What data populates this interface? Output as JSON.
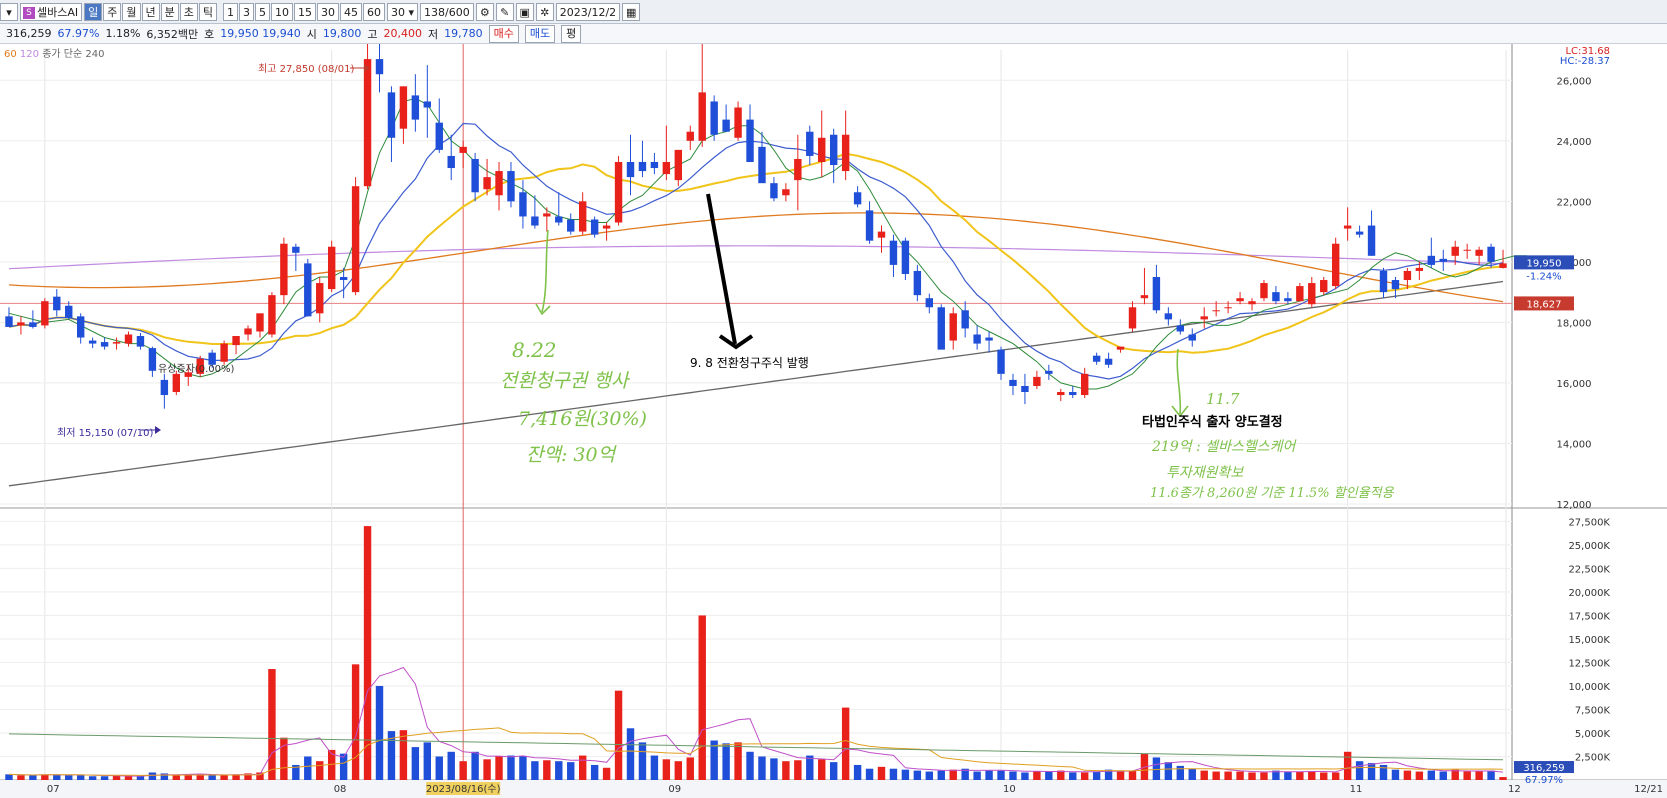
{
  "toolbar": {
    "stock_name": "셀바스AI",
    "logo_glyph": "S",
    "period_buttons": [
      "일",
      "주",
      "월",
      "년",
      "분",
      "초",
      "틱"
    ],
    "interval_buttons": [
      "1",
      "3",
      "5",
      "10",
      "15",
      "30",
      "45",
      "60"
    ],
    "interval_select": "30",
    "count": "138/600",
    "date": "2023/12/2"
  },
  "quote": {
    "volume": "316,259",
    "turnover_pct": "67.97%",
    "change_pct": "1.18%",
    "amount": "6,352백만",
    "ho_label": "호",
    "ho_values": "19,950  19,940",
    "open_label": "시",
    "open": "19,800",
    "high_label": "고",
    "high": "20,400",
    "low_label": "저",
    "low": "19,780",
    "buy_label": "매수",
    "sell_label": "매도",
    "avg_label": "평"
  },
  "legend": {
    "ma_items": [
      "60",
      "120"
    ],
    "extra": "종가 단순 240"
  },
  "annotations": {
    "high_label": "최고 27,850 (08/01)",
    "low_label": "최저 15,150 (07/10)",
    "rights_label": "유상증자(0.00%)",
    "note_sep8": "9. 8 전환청구주식 발행",
    "note_nov": "타법인주식 출자 양도결정",
    "hand_aug_1": "8.22",
    "hand_aug_2": "전환청구권 행사",
    "hand_aug_3": "7,416원(30%)",
    "hand_aug_4": "잔액: 30억",
    "hand_nov_date": "11.7",
    "hand_nov_1": "219억 : 셀바스헬스케어",
    "hand_nov_2": "투자재원확보",
    "hand_nov_3": "11.6종가 8,260원 기준 11.5% 할인율적용"
  },
  "price_axis": {
    "lc": "LC:31.68",
    "hc": "HC:-28.37",
    "current": "19,950",
    "current_change": "-1.24%",
    "ref_line": "18,627",
    "ticks": [
      "26,000",
      "24,000",
      "22,000",
      "20,000",
      "18,000",
      "16,000",
      "14,000",
      "12,000"
    ]
  },
  "volume_axis": {
    "ticks": [
      "27,500K",
      "25,000K",
      "22,500K",
      "20,000K",
      "17,500K",
      "15,000K",
      "12,500K",
      "10,000K",
      "7,500K",
      "5,000K",
      "2,500K"
    ],
    "current": "316,259",
    "current_pct": "67.97%"
  },
  "x_axis": {
    "labels": [
      "07",
      "08",
      "09",
      "10",
      "11",
      "12"
    ],
    "cursor_label": "2023/08/16(수)",
    "last_label": "12/21"
  },
  "colors": {
    "up": "#e8211b",
    "down": "#1f4fd8",
    "ma5": "#2e8b3a",
    "ma10": "#3d5ccf",
    "ma20": "#f0c419",
    "ma60": "#e07a1f",
    "ma120": "#c08ae0",
    "ma240": "#666666",
    "crosshair": "#e06060",
    "hand": "#7fc24a"
  },
  "chart_data": {
    "type": "candlestick",
    "y_range": [
      12000,
      27000
    ],
    "candles": [
      {
        "o": 18200,
        "h": 18500,
        "l": 17950,
        "c": 17850
      },
      {
        "o": 17900,
        "h": 18200,
        "l": 17600,
        "c": 18000
      },
      {
        "o": 18000,
        "h": 18400,
        "l": 17800,
        "c": 17850
      },
      {
        "o": 17900,
        "h": 18800,
        "l": 17800,
        "c": 18700
      },
      {
        "o": 18850,
        "h": 19100,
        "l": 18200,
        "c": 18400
      },
      {
        "o": 18550,
        "h": 18700,
        "l": 18100,
        "c": 18150
      },
      {
        "o": 18200,
        "h": 18300,
        "l": 17300,
        "c": 17500
      },
      {
        "o": 17400,
        "h": 17500,
        "l": 17150,
        "c": 17300
      },
      {
        "o": 17350,
        "h": 17500,
        "l": 17100,
        "c": 17200
      },
      {
        "o": 17300,
        "h": 17500,
        "l": 17100,
        "c": 17350
      },
      {
        "o": 17300,
        "h": 17700,
        "l": 17200,
        "c": 17600
      },
      {
        "o": 17550,
        "h": 17650,
        "l": 17100,
        "c": 17200
      },
      {
        "o": 17150,
        "h": 17200,
        "l": 16200,
        "c": 16400
      },
      {
        "o": 16100,
        "h": 16300,
        "l": 15150,
        "c": 15600
      },
      {
        "o": 15700,
        "h": 16400,
        "l": 15600,
        "c": 16300
      },
      {
        "o": 16200,
        "h": 16600,
        "l": 15900,
        "c": 16350
      },
      {
        "o": 16300,
        "h": 16900,
        "l": 16200,
        "c": 16800
      },
      {
        "o": 17000,
        "h": 17100,
        "l": 16500,
        "c": 16600
      },
      {
        "o": 16700,
        "h": 17400,
        "l": 16600,
        "c": 17300
      },
      {
        "o": 17250,
        "h": 17500,
        "l": 16950,
        "c": 17550
      },
      {
        "o": 17600,
        "h": 17900,
        "l": 17400,
        "c": 17800
      },
      {
        "o": 17700,
        "h": 18300,
        "l": 17500,
        "c": 18300
      },
      {
        "o": 17600,
        "h": 19000,
        "l": 17500,
        "c": 18900
      },
      {
        "o": 18900,
        "h": 20800,
        "l": 18600,
        "c": 20600
      },
      {
        "o": 20500,
        "h": 20600,
        "l": 19700,
        "c": 20300
      },
      {
        "o": 19950,
        "h": 20100,
        "l": 18200,
        "c": 18200
      },
      {
        "o": 18300,
        "h": 19500,
        "l": 18000,
        "c": 19300
      },
      {
        "o": 19100,
        "h": 20700,
        "l": 19000,
        "c": 20500
      },
      {
        "o": 19500,
        "h": 19800,
        "l": 18800,
        "c": 19400
      },
      {
        "o": 19000,
        "h": 22800,
        "l": 18900,
        "c": 22500
      },
      {
        "o": 22500,
        "h": 27850,
        "l": 22400,
        "c": 26700
      },
      {
        "o": 26700,
        "h": 27500,
        "l": 25600,
        "c": 26200
      },
      {
        "o": 25600,
        "h": 25800,
        "l": 23300,
        "c": 24100
      },
      {
        "o": 24400,
        "h": 25800,
        "l": 23900,
        "c": 25800
      },
      {
        "o": 25500,
        "h": 26200,
        "l": 24300,
        "c": 24700
      },
      {
        "o": 25300,
        "h": 26500,
        "l": 24100,
        "c": 25100
      },
      {
        "o": 24600,
        "h": 25400,
        "l": 23600,
        "c": 23700
      },
      {
        "o": 23500,
        "h": 24200,
        "l": 22700,
        "c": 23100
      },
      {
        "o": 23600,
        "h": 24000,
        "l": 23100,
        "c": 23800
      },
      {
        "o": 23400,
        "h": 23600,
        "l": 22000,
        "c": 22300
      },
      {
        "o": 22400,
        "h": 23400,
        "l": 22200,
        "c": 22800
      },
      {
        "o": 22200,
        "h": 23300,
        "l": 21700,
        "c": 23000
      },
      {
        "o": 23000,
        "h": 23300,
        "l": 21800,
        "c": 22000
      },
      {
        "o": 22300,
        "h": 22700,
        "l": 21100,
        "c": 21500
      },
      {
        "o": 21500,
        "h": 22200,
        "l": 21100,
        "c": 21200
      },
      {
        "o": 21500,
        "h": 21800,
        "l": 21000,
        "c": 21600
      },
      {
        "o": 21500,
        "h": 22300,
        "l": 21200,
        "c": 21300
      },
      {
        "o": 21400,
        "h": 21600,
        "l": 20900,
        "c": 21000
      },
      {
        "o": 21000,
        "h": 22300,
        "l": 20900,
        "c": 22000
      },
      {
        "o": 21400,
        "h": 21500,
        "l": 20800,
        "c": 20900
      },
      {
        "o": 21100,
        "h": 21300,
        "l": 20700,
        "c": 21200
      },
      {
        "o": 21300,
        "h": 23500,
        "l": 21200,
        "c": 23300
      },
      {
        "o": 23300,
        "h": 24200,
        "l": 22200,
        "c": 22800
      },
      {
        "o": 23300,
        "h": 24000,
        "l": 22800,
        "c": 23000
      },
      {
        "o": 23300,
        "h": 23600,
        "l": 22900,
        "c": 23100
      },
      {
        "o": 22900,
        "h": 24500,
        "l": 22700,
        "c": 23300
      },
      {
        "o": 22700,
        "h": 23700,
        "l": 22500,
        "c": 23700
      },
      {
        "o": 24000,
        "h": 24500,
        "l": 23700,
        "c": 24300
      },
      {
        "o": 24000,
        "h": 27300,
        "l": 23800,
        "c": 25600
      },
      {
        "o": 25300,
        "h": 25500,
        "l": 24000,
        "c": 24200
      },
      {
        "o": 24700,
        "h": 25200,
        "l": 24400,
        "c": 24300
      },
      {
        "o": 24100,
        "h": 25300,
        "l": 24000,
        "c": 25100
      },
      {
        "o": 24700,
        "h": 25200,
        "l": 23900,
        "c": 23300
      },
      {
        "o": 23800,
        "h": 24300,
        "l": 22900,
        "c": 22600
      },
      {
        "o": 22600,
        "h": 22800,
        "l": 22000,
        "c": 22100
      },
      {
        "o": 22200,
        "h": 22600,
        "l": 22000,
        "c": 22400
      },
      {
        "o": 22700,
        "h": 24200,
        "l": 21700,
        "c": 23400
      },
      {
        "o": 24300,
        "h": 24500,
        "l": 23200,
        "c": 23500
      },
      {
        "o": 23300,
        "h": 25000,
        "l": 22800,
        "c": 24100
      },
      {
        "o": 24200,
        "h": 24400,
        "l": 22600,
        "c": 23200
      },
      {
        "o": 23000,
        "h": 25000,
        "l": 22700,
        "c": 24200
      },
      {
        "o": 22300,
        "h": 22500,
        "l": 21800,
        "c": 21900
      },
      {
        "o": 21700,
        "h": 22000,
        "l": 20600,
        "c": 20700
      },
      {
        "o": 20800,
        "h": 21200,
        "l": 20300,
        "c": 21000
      },
      {
        "o": 20700,
        "h": 20900,
        "l": 19500,
        "c": 19900
      },
      {
        "o": 20700,
        "h": 20800,
        "l": 19400,
        "c": 19600
      },
      {
        "o": 19700,
        "h": 19900,
        "l": 18700,
        "c": 18900
      },
      {
        "o": 18800,
        "h": 18950,
        "l": 18300,
        "c": 18500
      },
      {
        "o": 18500,
        "h": 18600,
        "l": 17200,
        "c": 17100
      },
      {
        "o": 17400,
        "h": 18500,
        "l": 17100,
        "c": 18300
      },
      {
        "o": 18400,
        "h": 18700,
        "l": 17500,
        "c": 17800
      },
      {
        "o": 17600,
        "h": 17900,
        "l": 17100,
        "c": 17300
      },
      {
        "o": 17500,
        "h": 17700,
        "l": 17000,
        "c": 17400
      },
      {
        "o": 17100,
        "h": 17200,
        "l": 16100,
        "c": 16300
      },
      {
        "o": 16100,
        "h": 16300,
        "l": 15600,
        "c": 15900
      },
      {
        "o": 15900,
        "h": 16300,
        "l": 15300,
        "c": 15700
      },
      {
        "o": 15900,
        "h": 16400,
        "l": 15800,
        "c": 16200
      },
      {
        "o": 16400,
        "h": 16600,
        "l": 16100,
        "c": 16300
      },
      {
        "o": 15600,
        "h": 15800,
        "l": 15400,
        "c": 15700
      },
      {
        "o": 15700,
        "h": 15900,
        "l": 15500,
        "c": 15600
      },
      {
        "o": 15600,
        "h": 16500,
        "l": 15500,
        "c": 16300
      },
      {
        "o": 16900,
        "h": 17000,
        "l": 16600,
        "c": 16700
      },
      {
        "o": 16800,
        "h": 17000,
        "l": 16500,
        "c": 16600
      },
      {
        "o": 17100,
        "h": 17200,
        "l": 17000,
        "c": 17200
      },
      {
        "o": 17800,
        "h": 18700,
        "l": 17700,
        "c": 18500
      },
      {
        "o": 18800,
        "h": 19800,
        "l": 18600,
        "c": 18900
      },
      {
        "o": 19500,
        "h": 19900,
        "l": 18300,
        "c": 18400
      },
      {
        "o": 18300,
        "h": 18500,
        "l": 17900,
        "c": 18100
      },
      {
        "o": 17900,
        "h": 18100,
        "l": 17600,
        "c": 17700
      },
      {
        "o": 17600,
        "h": 17800,
        "l": 17200,
        "c": 17400
      },
      {
        "o": 18100,
        "h": 18500,
        "l": 17800,
        "c": 18200
      },
      {
        "o": 18400,
        "h": 18700,
        "l": 18200,
        "c": 18400
      },
      {
        "o": 18500,
        "h": 18700,
        "l": 18300,
        "c": 18500
      },
      {
        "o": 18700,
        "h": 19000,
        "l": 18600,
        "c": 18800
      },
      {
        "o": 18600,
        "h": 18800,
        "l": 18400,
        "c": 18700
      },
      {
        "o": 18800,
        "h": 19400,
        "l": 18700,
        "c": 19300
      },
      {
        "o": 19000,
        "h": 19200,
        "l": 18600,
        "c": 18700
      },
      {
        "o": 18800,
        "h": 19000,
        "l": 18600,
        "c": 18700
      },
      {
        "o": 18700,
        "h": 19300,
        "l": 18700,
        "c": 19200
      },
      {
        "o": 18600,
        "h": 19500,
        "l": 18500,
        "c": 19300
      },
      {
        "o": 19000,
        "h": 19500,
        "l": 18900,
        "c": 19400
      },
      {
        "o": 19200,
        "h": 20800,
        "l": 19100,
        "c": 20600
      },
      {
        "o": 21100,
        "h": 21800,
        "l": 20700,
        "c": 21200
      },
      {
        "o": 21000,
        "h": 21200,
        "l": 20800,
        "c": 20900
      },
      {
        "o": 21200,
        "h": 21700,
        "l": 20200,
        "c": 20200
      },
      {
        "o": 19700,
        "h": 19800,
        "l": 18800,
        "c": 19000
      },
      {
        "o": 19400,
        "h": 19500,
        "l": 18800,
        "c": 19100
      },
      {
        "o": 19400,
        "h": 19800,
        "l": 19100,
        "c": 19700
      },
      {
        "o": 19700,
        "h": 20000,
        "l": 19400,
        "c": 19800
      },
      {
        "o": 20200,
        "h": 20800,
        "l": 19800,
        "c": 19900
      },
      {
        "o": 20100,
        "h": 20400,
        "l": 19700,
        "c": 20000
      },
      {
        "o": 20200,
        "h": 20700,
        "l": 19900,
        "c": 20500
      },
      {
        "o": 20400,
        "h": 20600,
        "l": 20100,
        "c": 20400
      },
      {
        "o": 20200,
        "h": 20500,
        "l": 19900,
        "c": 20400
      },
      {
        "o": 20500,
        "h": 20600,
        "l": 19800,
        "c": 20000
      },
      {
        "o": 19800,
        "h": 20400,
        "l": 19780,
        "c": 19950
      }
    ],
    "volume": [
      600,
      500,
      500,
      600,
      600,
      500,
      500,
      400,
      400,
      450,
      400,
      400,
      800,
      700,
      500,
      600,
      600,
      500,
      500,
      600,
      700,
      800,
      11800,
      4500,
      1600,
      2500,
      2000,
      3200,
      2800,
      12300,
      27000,
      10000,
      5200,
      5300,
      3500,
      4000,
      2500,
      3000,
      2000,
      3000,
      2200,
      2500,
      2600,
      2500,
      2000,
      2100,
      2000,
      1900,
      2600,
      1600,
      1300,
      9500,
      5500,
      4000,
      2600,
      2200,
      2000,
      2400,
      17500,
      4200,
      3900,
      4000,
      3000,
      2500,
      2300,
      2000,
      2100,
      2600,
      2200,
      1900,
      7700,
      1600,
      1200,
      1400,
      1200,
      1100,
      1000,
      900,
      1000,
      1100,
      1200,
      900,
      1000,
      1000,
      900,
      800,
      900,
      900,
      1000,
      800,
      800,
      900,
      1100,
      1000,
      1000,
      2800,
      2400,
      1900,
      1500,
      1200,
      1000,
      900,
      900,
      900,
      800,
      800,
      1000,
      900,
      900,
      900,
      800,
      800,
      3000,
      2000,
      1800,
      1600,
      1100,
      1000,
      900,
      1000,
      900,
      1100,
      900,
      900,
      1000,
      316
    ],
    "ma5": [
      18300,
      18200,
      18100,
      18000,
      18050,
      18100,
      17900,
      17700,
      17500,
      17400,
      17300,
      17300,
      17100,
      16800,
      16500,
      16300,
      16200,
      16300,
      16500,
      16800,
      17100,
      17400,
      17800,
      18400,
      19000,
      19300,
      19500,
      19500,
      19700,
      20800,
      22300,
      23600,
      24400,
      25300,
      25400,
      25200,
      24600,
      24000,
      23700,
      23300,
      23000,
      22800,
      22600,
      22400,
      22100,
      21700,
      21500,
      21400,
      21400,
      21300,
      21300,
      21700,
      22000,
      22200,
      22600,
      23000,
      23200,
      23400,
      24000,
      24200,
      24300,
      24500,
      24500,
      24200,
      23700,
      23100,
      22800,
      22700,
      22800,
      23000,
      23300,
      23000,
      22400,
      21700,
      21000,
      20400,
      20000,
      19500,
      19000,
      18700,
      18300,
      17900,
      17700,
      17500,
      17300,
      17000,
      16700,
      16300,
      16000,
      15900,
      15800,
      15800,
      15900,
      16100,
      16300,
      16700,
      17200,
      17600,
      17900,
      18000,
      18000,
      17900,
      17900,
      18000,
      18200,
      18400,
      18500,
      18600,
      18700,
      18800,
      18900,
      19000,
      19100,
      19400,
      19800,
      20100,
      20300,
      20200,
      20000,
      19800,
      19600,
      19500,
      19600,
      19800,
      20000,
      20100,
      20200,
      20200
    ]
  }
}
